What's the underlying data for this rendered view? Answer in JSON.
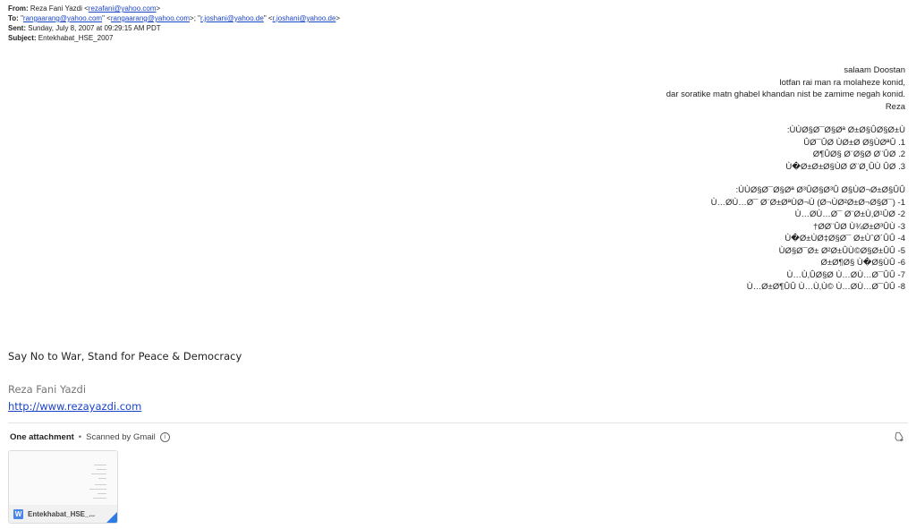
{
  "header": {
    "from_label": "From:",
    "from_name": "Reza Fani Yazdi",
    "from_email": "rezafani@yahoo.com",
    "to_label": "To:",
    "to_q1": "rangaarang@yahoo.com",
    "to_e1": "rangaarang@yahoo.com",
    "to_q2": "r.joshani@yahoo.de",
    "to_e2": "r.joshani@yahoo.de",
    "sent_label": "Sent:",
    "sent_value": "Sunday, July 8, 2007 at 09:29:15 AM PDT",
    "subject_label": "Subject:",
    "subject_value": "Entekhabat_HSE_2007"
  },
  "body": {
    "greeting_lines": [
      "salaam Doostan",
      "lotfan rai man ra molaheze konid,",
      "dar soratike matn ghabel khandan nist be zamime negah konid.",
      "Reza"
    ],
    "block1": [
      ":ÙÙØ§Ø¯Ø§Øª Ø±Ø§ÛØ§Ø±Ù",
      "ÛØ¯ÛØ ÙØ±Ø Ø§ÙØªÛ .1",
      "Ø¶ÛØ§ Ø¨Ø§Ø Ø¨ÛØ .2",
      "Ù�Ø±Ø±Ø§ÙØ Ø¨Ø¸ÛÙ ÛØ .3"
    ],
    "block2": [
      ":ÙÙØ§Ø¯Ø§Øª Ø³ÛØ§Ø³Û Ø§ÙØ¬Ø±Ø§ÛÛ",
      "Ù…ØÙ…Ø¯ Ø¨Ø±ØªÙØ¬Ù (Ø¬ÙØ²Ø±Ø¬Ø§Ø¯) -1",
      "Ù…ØÙ…Ø¯ Ø¨Ø±Ù‚Ø¹ÛØ -2",
      "†ØØ¨ÛØ Ù¾Ø±Ø³ÛÙ -3",
      "Ù�Ø±ÙØ‡Ø§Ø¯ Ø±ÙˆØ´ÛÛ -4",
      "ÙØ§Ø¯Ø± Ø²Ø±ÛÙ©Ø§Ø±ÛÛ -5",
      "Ø±Ø¶Ø§ Ù�Ø§ÙÛ -6",
      "Ù…Ù‚ÛØ§Ø Ù…ØÙ…Ø¯ÛÛ -7",
      "Ù…Ø±Ø¶ÛÛ Ù…Ù‚Ù© Ù…ØÙ…Ø¯ÛÛ -8"
    ]
  },
  "signature": {
    "slogan": "Say No to War, Stand for Peace & Democracy",
    "name": "Reza Fani Yazdi",
    "url": "http://www.rezayazdi.com"
  },
  "attachments": {
    "count_label": "One attachment",
    "separator": "•",
    "scan_label": "Scanned by Gmail",
    "file_name": "Entekhabat_HSE_...",
    "file_type_badge": "W",
    "drive_icon": "add-to-drive-icon",
    "colors": {
      "word_blue": "#4a86e8",
      "corner_blue": "#2d7be5",
      "link": "#1a44c8"
    }
  }
}
